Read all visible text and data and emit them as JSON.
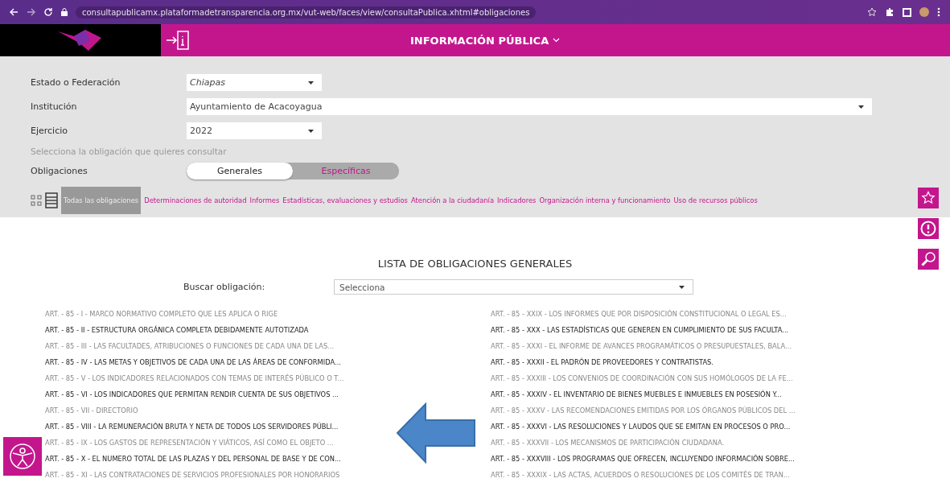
{
  "browser": {
    "url": "consultapublicamx.plataformadetransparencia.org.mx/vut-web/faces/view/consultaPublica.xhtml#obligaciones"
  },
  "header": {
    "title": "INFORMACIÓN PÚBLICA"
  },
  "form": {
    "fields": [
      {
        "label": "Estado o Federación",
        "value": "Chiapas",
        "kind": "short"
      },
      {
        "label": "Institución",
        "value": "Ayuntamiento de Acacoyagua",
        "kind": "long"
      },
      {
        "label": "Ejercicio",
        "value": "2022",
        "kind": "short"
      }
    ],
    "hint": "Selecciona la obligación que quieres consultar",
    "obligaciones_label": "Obligaciones",
    "toggle": [
      {
        "label": "Generales",
        "selected": true
      },
      {
        "label": "Específicas",
        "selected": false
      }
    ]
  },
  "filters": [
    {
      "label": "Todas las obligaciones",
      "selected": true
    },
    {
      "label": "Determinaciones de autoridad",
      "selected": false
    },
    {
      "label": "Informes",
      "selected": false
    },
    {
      "label": "Estadísticas, evaluaciones y estudios",
      "selected": false
    },
    {
      "label": "Atención a la ciudadanía",
      "selected": false
    },
    {
      "label": "Indicadores",
      "selected": false
    },
    {
      "label": "Organización interna y funcionamiento",
      "selected": false
    },
    {
      "label": "Uso de recursos públicos",
      "selected": false
    }
  ],
  "list": {
    "title": "LISTA DE OBLIGACIONES GENERALES",
    "search_label": "Buscar obligación:",
    "search_value": "Selecciona",
    "left": [
      "ART. - 85 - I - MARCO NORMATIVO COMPLETO QUE LES APLICA O RIGE",
      "ART. - 85 - II - ESTRUCTURA ORGÁNICA COMPLETA DEBIDAMENTE AUTOTIZADA",
      "ART. - 85 - III - LAS FACULTADES, ATRIBUCIONES O FUNCIONES DE CADA UNA DE LAS...",
      "ART. - 85 - IV - LAS METAS Y OBJETIVOS DE CADA UNA DE LAS ÁREAS DE CONFORMIDA...",
      "ART. - 85 - V - LOS INDICADORES RELACIONADOS CON TEMAS DE INTERÉS PÚBLICO O T...",
      "ART. - 85 - VI - LOS INDICADORES QUE PERMITAN RENDIR CUENTA DE SUS OBJETIVOS ...",
      "ART. - 85 - VII - DIRECTORIO",
      "ART. - 85 - VIII - LA REMUNERACIÓN BRUTA Y NETA DE TODOS LOS SERVIDORES PÚBLI...",
      "ART. - 85 - IX - LOS GASTOS DE REPRESENTACIÓN Y VIÁTICOS, ASÍ COMO EL OBJETO ...",
      "ART. - 85 - X - EL NUMERO TOTAL DE LAS PLAZAS Y DEL PERSONAL DE BASE Y DE CON...",
      "ART. - 85 - XI - LAS CONTRATACIONES DE SERVICIOS PROFESIONALES POR HONORARIOS"
    ],
    "right": [
      "ART. - 85 - XXIX - LOS INFORMES QUE POR DISPOSICIÓN CONSTITUCIONAL O LEGAL ES...",
      "ART. - 85 - XXX - LAS ESTADÍSTICAS QUE GENEREN EN CUMPLIMIENTO DE SUS FACULTA...",
      "ART. - 85 - XXXI - EL INFORME DE AVANCES PROGRAMÁTICOS O PRESUPUESTALES, BALA...",
      "ART. - 85 - XXXII - EL PADRÓN DE PROVEEDORES Y CONTRATISTAS.",
      "ART. - 85 - XXXIII - LOS CONVENIOS DE COORDINACIÓN CON SUS HOMÓLOGOS DE LA FE...",
      "ART. - 85 - XXXIV - EL INVENTARIO DE BIENES MUEBLES E INMUEBLES EN POSESIÓN Y...",
      "ART. - 85 - XXXV - LAS RECOMENDACIONES EMITIDAS POR LOS ÓRGANOS PÚBLICOS DEL ...",
      "ART. - 85 - XXXVI - LAS RESOLUCIONES Y LAUDOS QUE SE EMITAN EN PROCESOS O PRO...",
      "ART. - 85 - XXXVII - LOS MECANISMOS DE PARTICIPACIÓN CIUDADANA.",
      "ART. - 85 - XXXVIII - LOS PROGRAMAS QUE OFRECEN, INCLUYENDO INFORMACIÓN SOBRE...",
      "ART. - 85 - XXXIX - LAS ACTAS, ACUERDOS O RESOLUCIONES DE LOS COMITÉS DE TRAN..."
    ]
  }
}
